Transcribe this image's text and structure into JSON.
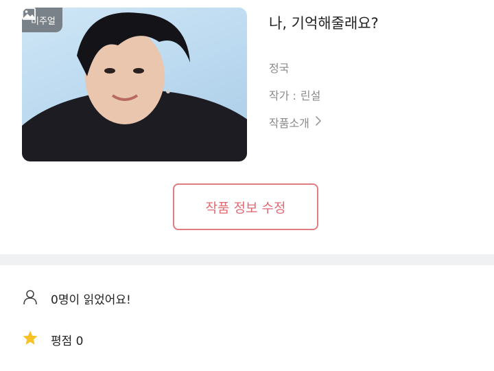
{
  "work": {
    "title": "나, 기억해줄래요?",
    "character": "정국",
    "author_label": "작가 :",
    "author_name": "린설",
    "intro_label": "작품소개"
  },
  "cover": {
    "badge_label": "비주얼"
  },
  "actions": {
    "edit_label": "작품 정보 수정"
  },
  "stats": {
    "reads_text": "0명이 읽었어요!",
    "rating_text": "평점 0"
  },
  "icons": {
    "badge": "image-icon",
    "intro": "chevron-right-icon",
    "reads": "person-icon",
    "rating": "star-icon"
  },
  "colors": {
    "accent": "#e06a72",
    "star": "#f6c227",
    "divider": "#f0f1f3",
    "muted_text": "#8a8a8a"
  }
}
